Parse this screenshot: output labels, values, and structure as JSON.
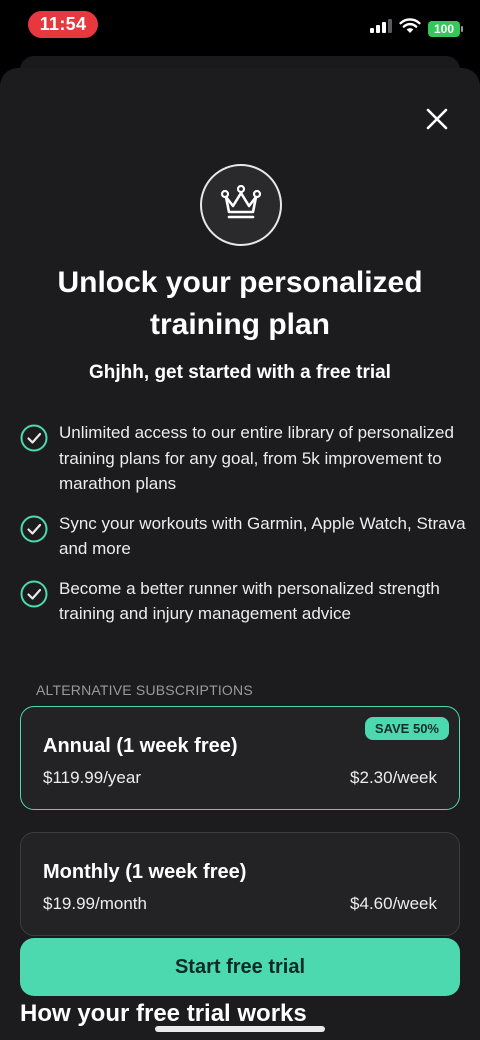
{
  "status_bar": {
    "time": "11:54",
    "battery": "100",
    "icons": [
      "cellular-signal-icon",
      "wifi-icon",
      "battery-icon"
    ]
  },
  "modal": {
    "close_icon": "close-icon",
    "crown_icon": "crown-icon",
    "title": "Unlock your personalized training plan",
    "subtitle": "Ghjhh, get started with a free trial"
  },
  "features": [
    {
      "icon": "check-circle-icon",
      "text": "Unlimited access to our entire library of personalized training plans for any goal, from 5k improvement to marathon plans"
    },
    {
      "icon": "check-circle-icon",
      "text": "Sync your workouts with Garmin, Apple Watch, Strava and more"
    },
    {
      "icon": "check-circle-icon",
      "text": "Become a better runner with personalized strength training and injury management advice"
    }
  ],
  "subscriptions": {
    "label": "ALTERNATIVE SUBSCRIPTIONS",
    "plans": [
      {
        "name": "Annual  (1 week free)",
        "price": "$119.99/year",
        "weekly": "$2.30/week",
        "badge": "SAVE 50%",
        "selected": true
      },
      {
        "name": "Monthly  (1 week free)",
        "price": "$19.99/month",
        "weekly": "$4.60/week",
        "selected": false
      }
    ]
  },
  "cta": {
    "label": "Start free trial"
  },
  "next_section": {
    "title": "How your free trial works"
  },
  "colors": {
    "accent": "#4dd9b0",
    "background": "#1c1c1e",
    "time_pill": "#e8383f",
    "battery": "#34c759"
  }
}
